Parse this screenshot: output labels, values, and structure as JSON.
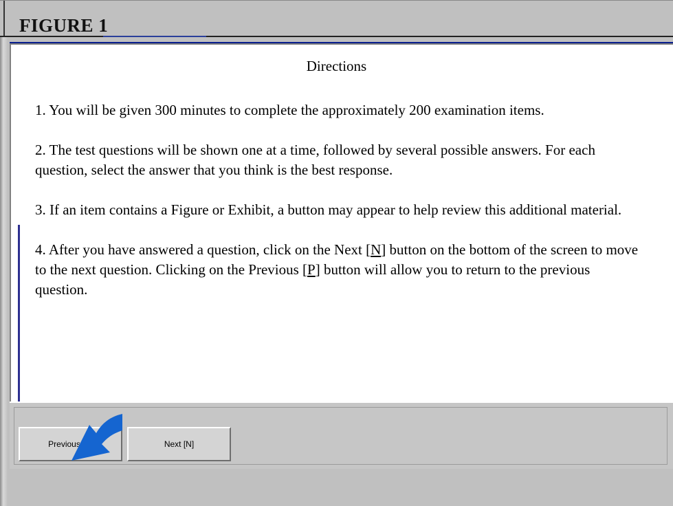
{
  "figure": {
    "title": "FIGURE 1"
  },
  "directions": {
    "heading": "Directions",
    "items": [
      {
        "text": "1. You will be given 300 minutes to complete the approximately 200 examination items."
      },
      {
        "text": "2. The test questions will be shown one at a time, followed by several possible answers. For each question, select the answer that you think is the best response."
      },
      {
        "text": "3. If an item contains a Figure or Exhibit, a button may appear to help review this additional material."
      },
      {
        "before": "4. After you have answered a question, click on the Next [",
        "key1": "N",
        "middle": "] button on the bottom of the screen to move to the next question.  Clicking on the Previous [",
        "key2": "P",
        "after": "] button will allow you to return to the previous question."
      }
    ]
  },
  "buttons": {
    "previous_label": "Previous [P]",
    "next_label": "Next [N]"
  },
  "colors": {
    "title_strip": "#0a1f8f",
    "window_gray": "#c0c0c0",
    "arrow": "#1565d0",
    "accent_line": "#2d2f8f"
  },
  "icons": {
    "pointer_arrow": "curved-arrow-icon"
  }
}
